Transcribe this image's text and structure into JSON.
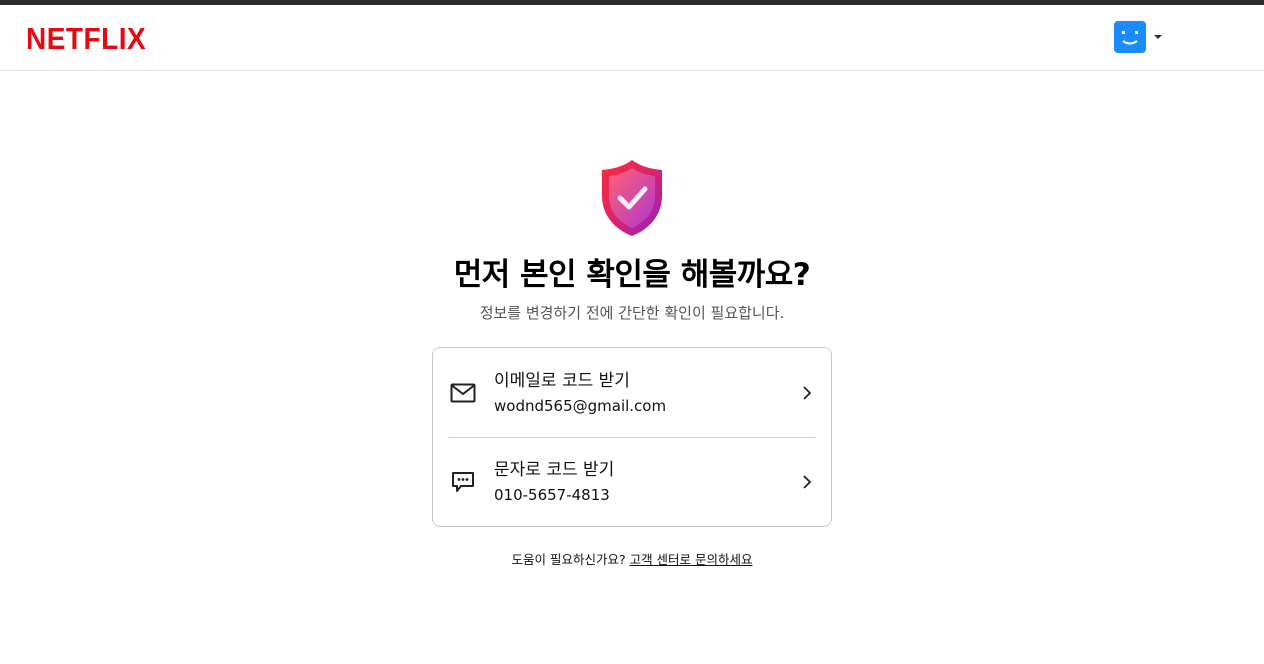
{
  "header": {
    "logo_text": "NETFLIX",
    "brand_color": "#e50914",
    "avatar_color": "#1a8cff"
  },
  "main": {
    "title": "먼저 본인 확인을 해볼까요?",
    "subtitle": "정보를 변경하기 전에 간단한 확인이 필요합니다.",
    "options": [
      {
        "icon": "envelope-icon",
        "label": "이메일로 코드 받기",
        "value": "wodnd565@gmail.com"
      },
      {
        "icon": "chat-bubble-icon",
        "label": "문자로 코드 받기",
        "value": "010-5657-4813"
      }
    ]
  },
  "help": {
    "prefix": "도움이 필요하신가요? ",
    "link_text": "고객 센터로 문의하세요"
  }
}
